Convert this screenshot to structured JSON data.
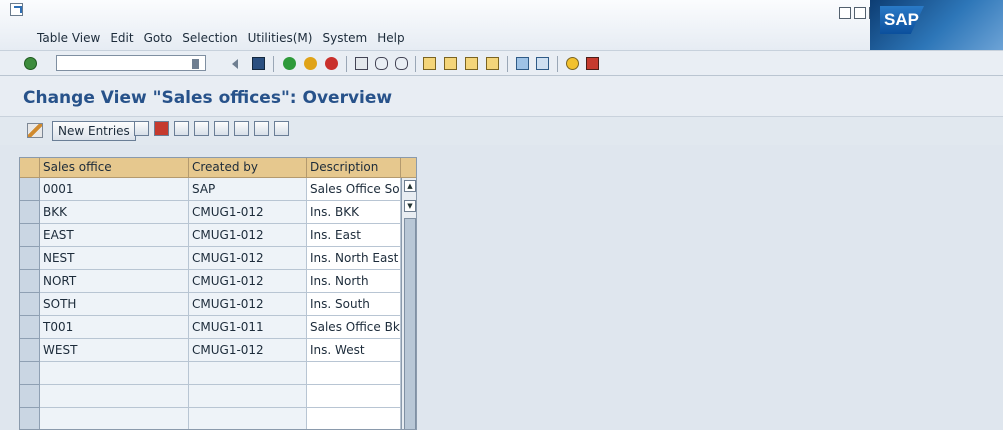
{
  "menu": {
    "items": [
      "Table View",
      "Edit",
      "Goto",
      "Selection",
      "Utilities(M)",
      "System",
      "Help"
    ]
  },
  "brand": {
    "logo_text": "SAP"
  },
  "command_field": {
    "value": ""
  },
  "title": "Change View \"Sales offices\": Overview",
  "app_toolbar": {
    "new_entries_label": "New Entries"
  },
  "table": {
    "columns": [
      "Sales office",
      "Created by",
      "Description"
    ],
    "rows": [
      [
        "0001",
        "SAP",
        "Sales Office Sou"
      ],
      [
        "BKK",
        "CMUG1-012",
        "Ins. BKK"
      ],
      [
        "EAST",
        "CMUG1-012",
        "Ins. East"
      ],
      [
        "NEST",
        "CMUG1-012",
        "Ins. North East"
      ],
      [
        "NORT",
        "CMUG1-012",
        "Ins. North"
      ],
      [
        "SOTH",
        "CMUG1-012",
        "Ins. South"
      ],
      [
        "T001",
        "CMUG1-011",
        "Sales Office Bkk"
      ],
      [
        "WEST",
        "CMUG1-012",
        "Ins. West"
      ]
    ],
    "empty_rows": 3
  },
  "colors": {
    "header_bg": "#e6c88e",
    "title_text": "#27528a",
    "row_bg": "#eef3f8"
  }
}
